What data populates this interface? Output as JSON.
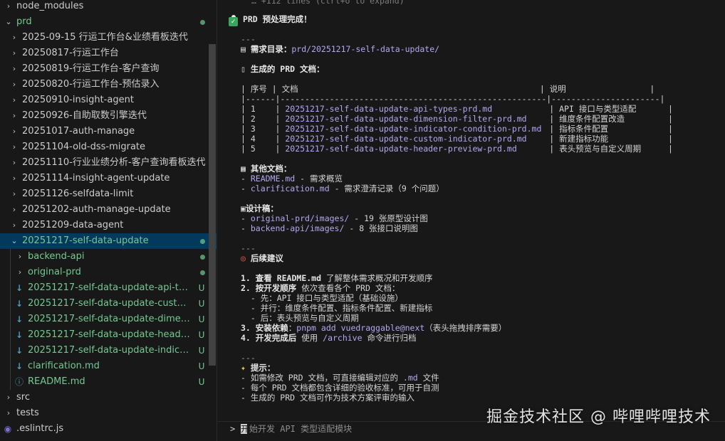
{
  "sidebar": {
    "node_modules": "node_modules",
    "prd": "prd",
    "folders": [
      "2025-09-15 行运工作台&业绩看板迭代",
      "20250817-行运工作台",
      "20250819-行运工作台-客户查询",
      "20250820-行运工作台-预估录入",
      "20250910-insight-agent",
      "20250926-自助取数引擎迭代",
      "20251017-auth-manage",
      "20251104-old-dss-migrate",
      "20251110-行业业绩分析-客户查询看板迭代",
      "20251114-insight-agent-update",
      "20251126-selfdata-limit",
      "20251202-auth-manage-update",
      "20251209-data-agent"
    ],
    "selected_folder": "20251217-self-data-update",
    "subfolders": [
      "backend-api",
      "original-prd"
    ],
    "files": [
      "20251217-self-data-update-api-types-prd.md",
      "20251217-self-data-update-custom-indicator-prd.md",
      "20251217-self-data-update-dimension-filter-prd.md",
      "20251217-self-data-update-header-preview-prd.md",
      "20251217-self-data-update-indicator-condition-prd.md",
      "clarification.md"
    ],
    "readme": "README.md",
    "untracked_badge": "U",
    "src": "src",
    "tests": "tests",
    "eslintrc": ".eslintrc.js"
  },
  "terminal": {
    "collapsed_hint": "… +112 lines (ctrl+o to expand)",
    "status": "PRD 预处理完成！",
    "hr": "---",
    "dir_label": "需求目录：",
    "dir_path": "prd/20251217-self-data-update/",
    "docs_heading": "生成的 PRD 文档：",
    "table_header": "| 序号 | 文档                                                 | 说明                 |",
    "table_sep": "|------|------------------------------------------------------|----------------------|",
    "table_rows": [
      {
        "no": "1",
        "doc": "20251217-self-data-update-api-types-prd.md",
        "desc": "API 接口与类型适配"
      },
      {
        "no": "2",
        "doc": "20251217-self-data-update-dimension-filter-prd.md",
        "desc": "维度条件配置改造"
      },
      {
        "no": "3",
        "doc": "20251217-self-data-update-indicator-condition-prd.md",
        "desc": "指标条件配置"
      },
      {
        "no": "4",
        "doc": "20251217-self-data-update-custom-indicator-prd.md",
        "desc": "新建指标功能"
      },
      {
        "no": "5",
        "doc": "20251217-self-data-update-header-preview-prd.md",
        "desc": "表头预览与自定义周期"
      }
    ],
    "other_heading": "其他文档：",
    "other_docs": [
      {
        "name": "README.md",
        "desc": " - 需求概览"
      },
      {
        "name": "clarification.md",
        "desc": " - 需求澄清记录（9 个问题）"
      }
    ],
    "design_heading": "设计稿：",
    "design_items": [
      {
        "name": "original-prd/images/",
        "desc": " - 19 张原型设计图"
      },
      {
        "name": "backend-api/images/",
        "desc": " - 8 张接口说明图"
      }
    ],
    "next_heading": "后续建议",
    "next_steps": {
      "s1_num": "1. ",
      "s1_bold": "查看 README.md",
      "s1_rest": " 了解整体需求概况和开发顺序",
      "s2_num": "2. ",
      "s2_bold": "按开发顺序",
      "s2_rest": " 依次查看各个 PRD 文档：",
      "s2_sub": [
        "  - 先：API 接口与类型适配（基础设施）",
        "  - 并行：维度条件配置、指标条件配置、新建指标",
        "  - 后：表头预览与自定义周期"
      ],
      "s3_num": "3. ",
      "s3_bold": "安装依赖",
      "s3_colon": "：",
      "s3_cmd": "pnpm add vuedraggable@next",
      "s3_rest": "（表头拖拽排序需要）",
      "s4_num": "4. ",
      "s4_bold": "开发完成后",
      "s4_rest1": " 使用 ",
      "s4_cmd": "/archive",
      "s4_rest2": " 命令进行归档"
    },
    "tip_heading": "提示：",
    "tips": [
      {
        "pre": "- 如需修改 PRD 文档，可直接编辑对应的 ",
        "code": ".md",
        "post": " 文件"
      },
      {
        "pre": "- 每个 PRD 文档都包含详细的验收标准，可用于自测",
        "code": "",
        "post": ""
      },
      {
        "pre": "- 生成的 PRD 文档可作为技术方案评审的输入",
        "code": "",
        "post": ""
      }
    ],
    "prompt_caret": ">",
    "prompt_first_char": "开",
    "prompt_text": "始开发 API 类型适配模块"
  },
  "watermark": "掘金技术社区 @ 哔哩哔哩技术",
  "colors": {
    "accent_green": "#73c991",
    "selection": "#04395e",
    "link": "#b3a8f0"
  }
}
